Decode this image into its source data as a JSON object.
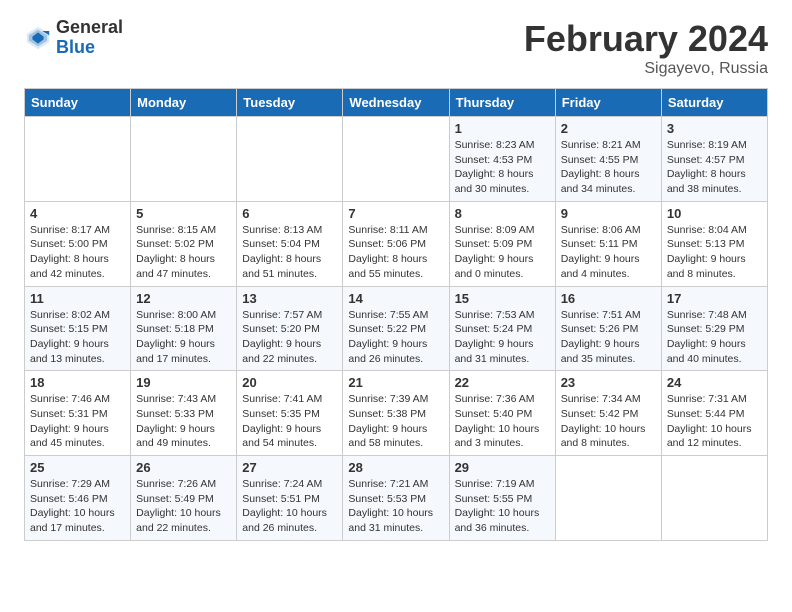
{
  "header": {
    "logo_general": "General",
    "logo_blue": "Blue",
    "month_title": "February 2024",
    "subtitle": "Sigayevo, Russia"
  },
  "weekdays": [
    "Sunday",
    "Monday",
    "Tuesday",
    "Wednesday",
    "Thursday",
    "Friday",
    "Saturday"
  ],
  "weeks": [
    [
      {
        "day": "",
        "info": ""
      },
      {
        "day": "",
        "info": ""
      },
      {
        "day": "",
        "info": ""
      },
      {
        "day": "",
        "info": ""
      },
      {
        "day": "1",
        "info": "Sunrise: 8:23 AM\nSunset: 4:53 PM\nDaylight: 8 hours and 30 minutes."
      },
      {
        "day": "2",
        "info": "Sunrise: 8:21 AM\nSunset: 4:55 PM\nDaylight: 8 hours and 34 minutes."
      },
      {
        "day": "3",
        "info": "Sunrise: 8:19 AM\nSunset: 4:57 PM\nDaylight: 8 hours and 38 minutes."
      }
    ],
    [
      {
        "day": "4",
        "info": "Sunrise: 8:17 AM\nSunset: 5:00 PM\nDaylight: 8 hours and 42 minutes."
      },
      {
        "day": "5",
        "info": "Sunrise: 8:15 AM\nSunset: 5:02 PM\nDaylight: 8 hours and 47 minutes."
      },
      {
        "day": "6",
        "info": "Sunrise: 8:13 AM\nSunset: 5:04 PM\nDaylight: 8 hours and 51 minutes."
      },
      {
        "day": "7",
        "info": "Sunrise: 8:11 AM\nSunset: 5:06 PM\nDaylight: 8 hours and 55 minutes."
      },
      {
        "day": "8",
        "info": "Sunrise: 8:09 AM\nSunset: 5:09 PM\nDaylight: 9 hours and 0 minutes."
      },
      {
        "day": "9",
        "info": "Sunrise: 8:06 AM\nSunset: 5:11 PM\nDaylight: 9 hours and 4 minutes."
      },
      {
        "day": "10",
        "info": "Sunrise: 8:04 AM\nSunset: 5:13 PM\nDaylight: 9 hours and 8 minutes."
      }
    ],
    [
      {
        "day": "11",
        "info": "Sunrise: 8:02 AM\nSunset: 5:15 PM\nDaylight: 9 hours and 13 minutes."
      },
      {
        "day": "12",
        "info": "Sunrise: 8:00 AM\nSunset: 5:18 PM\nDaylight: 9 hours and 17 minutes."
      },
      {
        "day": "13",
        "info": "Sunrise: 7:57 AM\nSunset: 5:20 PM\nDaylight: 9 hours and 22 minutes."
      },
      {
        "day": "14",
        "info": "Sunrise: 7:55 AM\nSunset: 5:22 PM\nDaylight: 9 hours and 26 minutes."
      },
      {
        "day": "15",
        "info": "Sunrise: 7:53 AM\nSunset: 5:24 PM\nDaylight: 9 hours and 31 minutes."
      },
      {
        "day": "16",
        "info": "Sunrise: 7:51 AM\nSunset: 5:26 PM\nDaylight: 9 hours and 35 minutes."
      },
      {
        "day": "17",
        "info": "Sunrise: 7:48 AM\nSunset: 5:29 PM\nDaylight: 9 hours and 40 minutes."
      }
    ],
    [
      {
        "day": "18",
        "info": "Sunrise: 7:46 AM\nSunset: 5:31 PM\nDaylight: 9 hours and 45 minutes."
      },
      {
        "day": "19",
        "info": "Sunrise: 7:43 AM\nSunset: 5:33 PM\nDaylight: 9 hours and 49 minutes."
      },
      {
        "day": "20",
        "info": "Sunrise: 7:41 AM\nSunset: 5:35 PM\nDaylight: 9 hours and 54 minutes."
      },
      {
        "day": "21",
        "info": "Sunrise: 7:39 AM\nSunset: 5:38 PM\nDaylight: 9 hours and 58 minutes."
      },
      {
        "day": "22",
        "info": "Sunrise: 7:36 AM\nSunset: 5:40 PM\nDaylight: 10 hours and 3 minutes."
      },
      {
        "day": "23",
        "info": "Sunrise: 7:34 AM\nSunset: 5:42 PM\nDaylight: 10 hours and 8 minutes."
      },
      {
        "day": "24",
        "info": "Sunrise: 7:31 AM\nSunset: 5:44 PM\nDaylight: 10 hours and 12 minutes."
      }
    ],
    [
      {
        "day": "25",
        "info": "Sunrise: 7:29 AM\nSunset: 5:46 PM\nDaylight: 10 hours and 17 minutes."
      },
      {
        "day": "26",
        "info": "Sunrise: 7:26 AM\nSunset: 5:49 PM\nDaylight: 10 hours and 22 minutes."
      },
      {
        "day": "27",
        "info": "Sunrise: 7:24 AM\nSunset: 5:51 PM\nDaylight: 10 hours and 26 minutes."
      },
      {
        "day": "28",
        "info": "Sunrise: 7:21 AM\nSunset: 5:53 PM\nDaylight: 10 hours and 31 minutes."
      },
      {
        "day": "29",
        "info": "Sunrise: 7:19 AM\nSunset: 5:55 PM\nDaylight: 10 hours and 36 minutes."
      },
      {
        "day": "",
        "info": ""
      },
      {
        "day": "",
        "info": ""
      }
    ]
  ]
}
